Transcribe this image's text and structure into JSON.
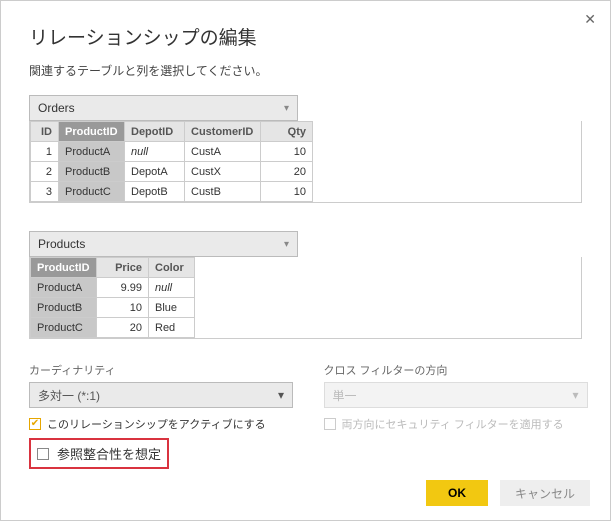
{
  "dialog": {
    "title": "リレーションシップの編集",
    "subtitle": "関連するテーブルと列を選択してください。"
  },
  "table1": {
    "name": "Orders",
    "headers": [
      "ID",
      "ProductID",
      "DepotID",
      "CustomerID",
      "Qty"
    ],
    "rows": [
      [
        "1",
        "ProductA",
        "null",
        "CustA",
        "10"
      ],
      [
        "2",
        "ProductB",
        "DepotA",
        "CustX",
        "20"
      ],
      [
        "3",
        "ProductC",
        "DepotB",
        "CustB",
        "10"
      ]
    ],
    "selected_col": 1
  },
  "table2": {
    "name": "Products",
    "headers": [
      "ProductID",
      "Price",
      "Color"
    ],
    "rows": [
      [
        "ProductA",
        "9.99",
        "null"
      ],
      [
        "ProductB",
        "10",
        "Blue"
      ],
      [
        "ProductC",
        "20",
        "Red"
      ]
    ],
    "selected_col": 0
  },
  "cardinality": {
    "label": "カーディナリティ",
    "value": "多対一 (*:1)"
  },
  "crossfilter": {
    "label": "クロス フィルターの方向",
    "value": "単一"
  },
  "checkboxes": {
    "active": "このリレーションシップをアクティブにする",
    "both_security": "両方向にセキュリティ フィルターを適用する",
    "referential": "参照整合性を想定"
  },
  "buttons": {
    "ok": "OK",
    "cancel": "キャンセル"
  }
}
